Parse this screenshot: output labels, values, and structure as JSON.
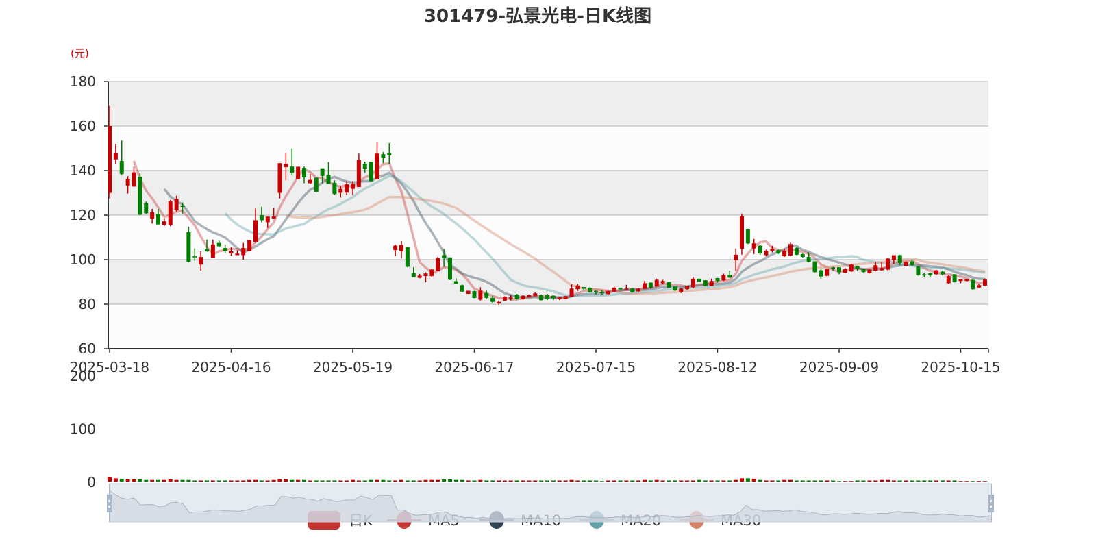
{
  "chart_data": {
    "type": "candlestick",
    "title": "301479-弘景光电-日K线图",
    "yunit": "(元)",
    "ylim": [
      60,
      180
    ],
    "yticks": [
      "180",
      "160",
      "140",
      "120",
      "100",
      "80",
      "60"
    ],
    "volume_ylim": [
      0,
      200
    ],
    "volume_ticks": [
      "200",
      "100",
      "0"
    ],
    "x_labels": [
      {
        "index": 0,
        "label": "2025-03-18"
      },
      {
        "index": 20,
        "label": "2025-04-16"
      },
      {
        "index": 40,
        "label": "2025-05-19"
      },
      {
        "index": 60,
        "label": "2025-06-17"
      },
      {
        "index": 80,
        "label": "2025-07-15"
      },
      {
        "index": 100,
        "label": "2025-08-12"
      },
      {
        "index": 120,
        "label": "2025-09-09"
      },
      {
        "index": 140,
        "label": "2025-10-15"
      }
    ],
    "ohlc_format": "[open, close, low, high]",
    "candles": [
      [
        130,
        160,
        127.5,
        169
      ],
      [
        145,
        147.8,
        143,
        152
      ],
      [
        144.3,
        138.5,
        137.8,
        153.5
      ],
      [
        133.3,
        136.2,
        129.7,
        137.5
      ],
      [
        132.8,
        139.2,
        132.8,
        141.8
      ],
      [
        137.2,
        120.2,
        120,
        138.8
      ],
      [
        125.3,
        120.8,
        120.6,
        126
      ],
      [
        118.3,
        121.3,
        116.2,
        122.8
      ],
      [
        120.5,
        115.8,
        115.8,
        122.8
      ],
      [
        115.7,
        117.2,
        115,
        118.5
      ],
      [
        115.5,
        126.3,
        115,
        126.8
      ],
      [
        122.2,
        127.3,
        121.5,
        128.7
      ],
      [
        124.3,
        123.7,
        120.7,
        125.7
      ],
      [
        112.3,
        99,
        98.8,
        114.8
      ],
      [
        101.5,
        101,
        99.5,
        105
      ],
      [
        97.8,
        101.2,
        95,
        103.7
      ],
      [
        104.8,
        103.7,
        103.5,
        109
      ],
      [
        100.8,
        106.8,
        100.8,
        109
      ],
      [
        107.5,
        106,
        105.5,
        108.5
      ],
      [
        105.2,
        104,
        103,
        106.8
      ],
      [
        102.8,
        103.7,
        101.8,
        105.5
      ],
      [
        102,
        102.7,
        102,
        104.2
      ],
      [
        102,
        105.2,
        100,
        107.5
      ],
      [
        103.8,
        108.8,
        103.8,
        108.8
      ],
      [
        108,
        117.7,
        107.5,
        123
      ],
      [
        120,
        117.7,
        116.7,
        123.8
      ],
      [
        116.8,
        119.3,
        114.2,
        119.3
      ],
      [
        118.5,
        119.4,
        118.5,
        123.2
      ],
      [
        130,
        143.3,
        127.5,
        143.3
      ],
      [
        141.5,
        143,
        135.5,
        148
      ],
      [
        141.8,
        139,
        137.8,
        150
      ],
      [
        136,
        141.7,
        136,
        141.7
      ],
      [
        141.2,
        137,
        134.3,
        141.8
      ],
      [
        134.3,
        135.8,
        134,
        138.5
      ],
      [
        136.8,
        130.5,
        130.3,
        137
      ],
      [
        141,
        137.6,
        134.3,
        141
      ],
      [
        138,
        134,
        134,
        143.8
      ],
      [
        134.5,
        129.5,
        129,
        135.6
      ],
      [
        130,
        131.8,
        127.8,
        133
      ],
      [
        130.1,
        133.8,
        129,
        135.3
      ],
      [
        131.8,
        134,
        129,
        135.3
      ],
      [
        132.6,
        144.8,
        132.6,
        147.6
      ],
      [
        143,
        140.8,
        139,
        144
      ],
      [
        144,
        135.2,
        135.2,
        144
      ],
      [
        136,
        147.6,
        136,
        152.6
      ],
      [
        147.3,
        145.8,
        143.3,
        148.3
      ],
      [
        147.8,
        146.8,
        142.8,
        152.3
      ],
      [
        104.3,
        106.3,
        101.6,
        106.8
      ],
      [
        103.8,
        106.6,
        100.5,
        108.3
      ],
      [
        105.6,
        96.8,
        96.6,
        105.6
      ],
      [
        94,
        92,
        92,
        96.6
      ],
      [
        91.8,
        92.8,
        91.6,
        93.6
      ],
      [
        92.6,
        93.8,
        89.8,
        94.3
      ],
      [
        92.6,
        95.6,
        92,
        96
      ],
      [
        94.8,
        100.6,
        94.8,
        101.3
      ],
      [
        102,
        100.6,
        96.8,
        104.8
      ],
      [
        101,
        91,
        90.8,
        101
      ],
      [
        90.3,
        89.1,
        89.1,
        91.6
      ],
      [
        88.5,
        85.6,
        85.3,
        88.8
      ],
      [
        84.6,
        86,
        84.6,
        86
      ],
      [
        85.8,
        82.8,
        82.6,
        86
      ],
      [
        82,
        86,
        81.6,
        87.6
      ],
      [
        85,
        82.8,
        82.3,
        86
      ],
      [
        82.8,
        81,
        80.4,
        83.8
      ],
      [
        80.3,
        81,
        79.8,
        81.5
      ],
      [
        81.6,
        83.3,
        81.5,
        83.5
      ],
      [
        82.6,
        83,
        81.6,
        84
      ],
      [
        84.3,
        82.3,
        82,
        84.6
      ],
      [
        82.3,
        83.8,
        82,
        84
      ],
      [
        83,
        84,
        83,
        84.3
      ],
      [
        83.6,
        84.8,
        83.5,
        85.3
      ],
      [
        84,
        81.8,
        81.6,
        84.3
      ],
      [
        84,
        82.3,
        81.8,
        84.6
      ],
      [
        83.8,
        82.6,
        81.8,
        84
      ],
      [
        82.3,
        83,
        81.8,
        83.2
      ],
      [
        82.3,
        83.6,
        82.2,
        83.8
      ],
      [
        83.3,
        87,
        83.3,
        89
      ],
      [
        86.7,
        88.4,
        85.9,
        89
      ],
      [
        87.7,
        86.9,
        86.1,
        87.7
      ],
      [
        87.4,
        85.4,
        85.2,
        87.6
      ],
      [
        85.9,
        85.4,
        84.3,
        86.1
      ],
      [
        85.4,
        84.9,
        84.3,
        86.1
      ],
      [
        84.5,
        85.9,
        84.3,
        86.1
      ],
      [
        85.7,
        87.4,
        85.4,
        87.9
      ],
      [
        87.4,
        86.7,
        86.1,
        87.4
      ],
      [
        86.7,
        87,
        86.1,
        88.7
      ],
      [
        87,
        85.4,
        85.2,
        87.2
      ],
      [
        85.7,
        87,
        85.5,
        87.2
      ],
      [
        86.9,
        89.4,
        86.7,
        90.4
      ],
      [
        89.7,
        87.4,
        87.1,
        89.7
      ],
      [
        87.9,
        90.9,
        87.9,
        91.4
      ],
      [
        89.4,
        90.4,
        88.9,
        90.9
      ],
      [
        89.9,
        87.4,
        87.1,
        89.9
      ],
      [
        87.9,
        86.1,
        85.9,
        88.1
      ],
      [
        85.5,
        87,
        85,
        87.2
      ],
      [
        86.7,
        88,
        86.5,
        88.2
      ],
      [
        87.6,
        91.4,
        87.1,
        92.1
      ],
      [
        91.4,
        90.1,
        90,
        91.5
      ],
      [
        90.7,
        88.2,
        88,
        90.8
      ],
      [
        88.2,
        90.4,
        88,
        91.4
      ],
      [
        91.7,
        90.4,
        89.7,
        91.8
      ],
      [
        90.7,
        93.1,
        90.4,
        93.7
      ],
      [
        93.1,
        91.9,
        91.7,
        95.1
      ],
      [
        99.8,
        102.2,
        95,
        105
      ],
      [
        104.9,
        119.4,
        102.2,
        120.7
      ],
      [
        113.6,
        107.3,
        107,
        113.8
      ],
      [
        105,
        107.3,
        102.5,
        109.3
      ],
      [
        106.3,
        102.8,
        102.2,
        106.5
      ],
      [
        102,
        104,
        101.5,
        104.5
      ],
      [
        104,
        104.8,
        103.2,
        106.2
      ],
      [
        104.2,
        102.8,
        102.5,
        104.5
      ],
      [
        101.5,
        104,
        101.2,
        105
      ],
      [
        101.8,
        107,
        101.5,
        107.6
      ],
      [
        105.3,
        102.2,
        102,
        105.6
      ],
      [
        102.5,
        101.2,
        101,
        102.7
      ],
      [
        101.2,
        99,
        98.8,
        103.2
      ],
      [
        99.2,
        94.4,
        94.2,
        99.3
      ],
      [
        95.2,
        92.4,
        91.4,
        95.7
      ],
      [
        92.7,
        95.8,
        92.5,
        96
      ],
      [
        96.5,
        96,
        95,
        96.8
      ],
      [
        96.5,
        94.4,
        93.4,
        96.6
      ],
      [
        94.1,
        95.7,
        94,
        96.2
      ],
      [
        94.7,
        97.8,
        94.5,
        98.2
      ],
      [
        97.2,
        96,
        95,
        97.3
      ],
      [
        95.7,
        94.4,
        94.1,
        96
      ],
      [
        93.9,
        95.5,
        93.8,
        95.6
      ],
      [
        95,
        97.5,
        94.8,
        99
      ],
      [
        95.2,
        96.2,
        95,
        99
      ],
      [
        95.5,
        100.5,
        95.2,
        100.8
      ],
      [
        100,
        102,
        98,
        102
      ],
      [
        102,
        98.5,
        97.5,
        102.2
      ],
      [
        97.2,
        99,
        97,
        99.2
      ],
      [
        99.2,
        97.5,
        97.2,
        100.2
      ],
      [
        97,
        93,
        92.8,
        97.1
      ],
      [
        93.4,
        92.9,
        92,
        94
      ],
      [
        93.9,
        92.9,
        92.4,
        94.1
      ],
      [
        93.4,
        95.2,
        93.3,
        95.3
      ],
      [
        94.6,
        93.4,
        92.9,
        94.9
      ],
      [
        89.4,
        92.6,
        89.1,
        92.9
      ],
      [
        93.4,
        89.9,
        89.7,
        93.5
      ],
      [
        90.4,
        91.1,
        89.4,
        91.2
      ],
      [
        90.4,
        91.1,
        90.2,
        91.3
      ],
      [
        90.9,
        86.7,
        86.5,
        91
      ],
      [
        87.5,
        88.5,
        87.3,
        89
      ],
      [
        88.3,
        91,
        88,
        91.5
      ]
    ],
    "volumes": [
      9,
      6,
      5,
      4,
      4,
      4,
      3,
      3,
      3,
      3,
      4,
      3,
      3,
      3,
      2,
      2,
      2,
      2,
      2,
      2,
      2,
      2,
      2,
      3,
      3,
      2,
      2,
      3,
      4,
      4,
      3,
      3,
      3,
      2,
      2,
      2,
      2,
      2,
      2,
      2,
      3,
      2,
      2,
      3,
      3,
      3,
      2,
      2,
      3,
      2,
      2,
      2,
      3,
      3,
      3,
      4,
      4,
      3,
      3,
      2,
      2,
      3,
      2,
      2,
      2,
      2,
      2,
      2,
      2,
      2,
      2,
      2,
      2,
      2,
      2,
      2,
      3,
      2,
      2,
      2,
      2,
      1,
      2,
      2,
      2,
      2,
      2,
      2,
      3,
      2,
      3,
      2,
      2,
      2,
      2,
      2,
      2,
      3,
      2,
      2,
      2,
      2,
      2,
      3,
      6,
      6,
      5,
      3,
      2,
      2,
      2,
      3,
      3,
      2,
      2,
      2,
      2,
      2,
      2,
      2,
      1,
      1,
      1,
      2,
      2,
      2,
      2,
      3,
      3,
      2,
      2,
      2,
      2,
      2,
      2,
      2,
      2,
      2,
      2,
      2,
      1,
      1,
      1,
      1,
      1
    ],
    "moving_averages": [
      5,
      10,
      20,
      30
    ],
    "legend": {
      "position": "bottom-center",
      "items": [
        {
          "label": "日K",
          "color": "#c23531"
        },
        {
          "label": "MA5",
          "color": "#c23531"
        },
        {
          "label": "MA10",
          "color": "#2f4554"
        },
        {
          "label": "MA20",
          "color": "#61a0a8"
        },
        {
          "label": "MA30",
          "color": "#d48265"
        }
      ]
    },
    "colors": {
      "up": "#c80000",
      "down": "#008000"
    },
    "grid": true,
    "datazoom": {
      "start_percent": 0,
      "end_percent": 100
    }
  }
}
